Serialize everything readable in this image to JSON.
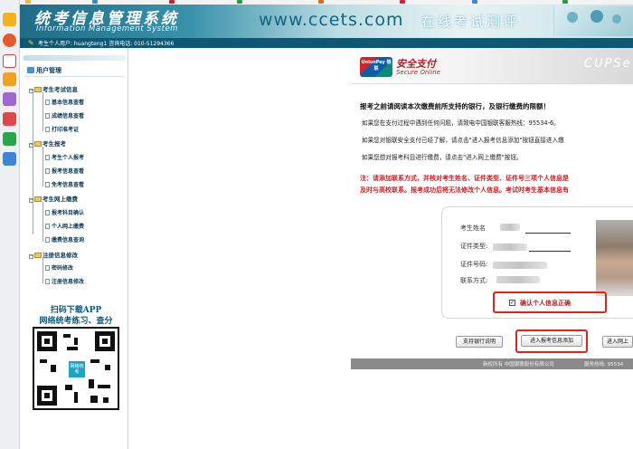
{
  "banner": {
    "system_title": "统考信息管理系统",
    "system_subtitle": "Information Management System",
    "site": "www.ccets.com",
    "slogan": "在线考试测评"
  },
  "userbar": {
    "text": "考生个人用户: huangteng1 咨询电话: 010-51294366"
  },
  "sidebar": {
    "title": "用户管理",
    "groups": [
      {
        "label": "考生考试信息",
        "items": [
          "基本信息查看",
          "成绩信息查看",
          "打印准考证"
        ]
      },
      {
        "label": "考生报考",
        "items": [
          "考生个人报考",
          "报考信息查看",
          "免考信息查看"
        ]
      },
      {
        "label": "考生网上缴费",
        "items": [
          "报考科目确认",
          "个人网上缴费",
          "缴费信息查询"
        ]
      },
      {
        "label": "注册信息修改",
        "items": [
          "密码修改",
          "注册信息修改"
        ]
      }
    ],
    "app_promo": "扫码下载APP\n网络统考练习、查分",
    "qr_center": "网络统考"
  },
  "payment": {
    "brand_logo_text": "UnionPay 银联",
    "secure_cn": "安全支付",
    "secure_en": "Secure Online",
    "cups": "CUPSe",
    "notice_title": "报考之前请阅读本次缴费前所支持的银行，及银行缴费的限额！",
    "notices": [
      "如果您在支付过程中遇到任何问题，请致电中国银联客服热线：95534-6。",
      "如果您对银联安全支付已经了解，请点击\"进入报考信息添加\"按钮直接进入缴",
      "如果您想对报考科目进行缴费，请点击\"进入网上缴费\"按钮。"
    ],
    "warnings": [
      "注：请添加联系方式，并核对考生姓名、证件类型、证件号三项个人信息是",
      "及时与高校联系。报考成功后将无法修改个人信息。考试时考生基本信息有"
    ],
    "fields": [
      "考生姓名",
      "证件类型:",
      "证件号码:",
      "联系方式:"
    ],
    "confirm_label": "确认个人信息正确",
    "buttons": {
      "bank_info": "支持银行说明",
      "add_info": "进入报考信息添加",
      "online_pay": "进入网上"
    },
    "footer": {
      "copyright": "新权所有 中国银联股份有限公司",
      "hotline": "服务热线: 95534"
    }
  }
}
